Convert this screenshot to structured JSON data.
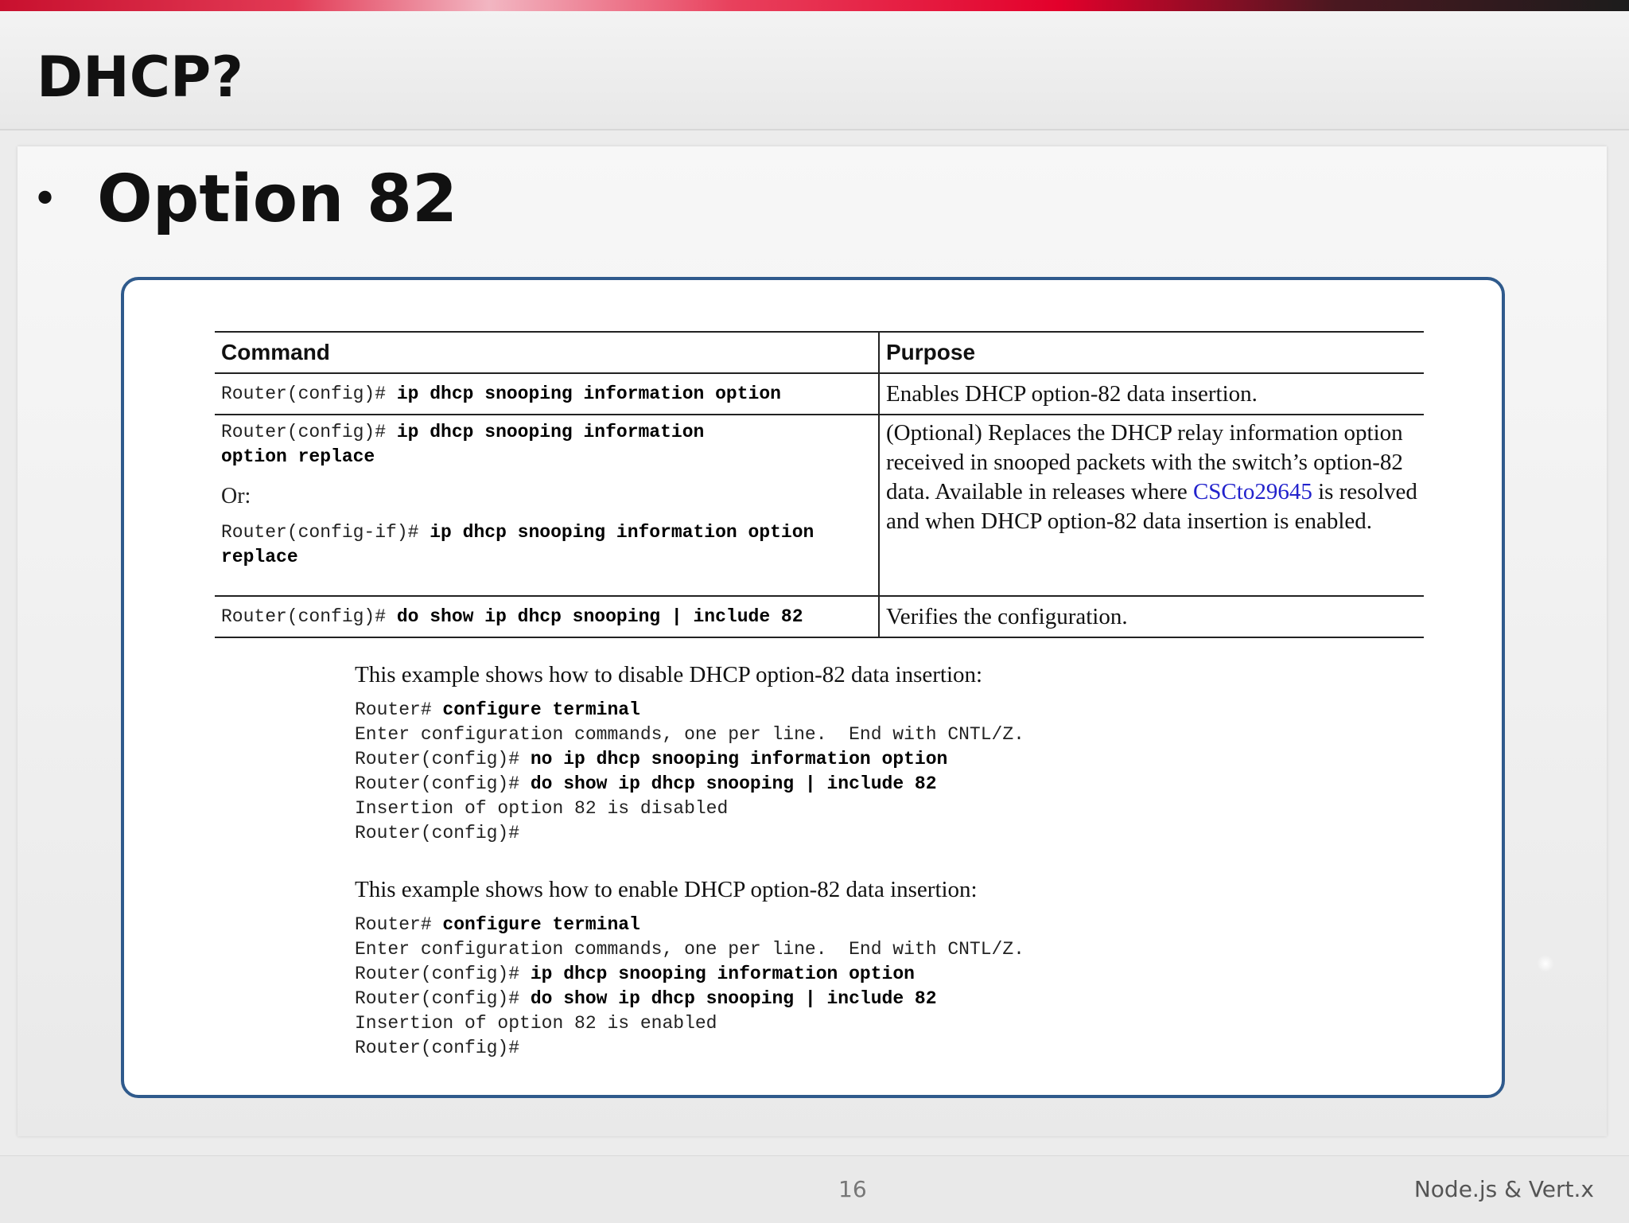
{
  "slide": {
    "title": "DHCP?",
    "bullet": "Option 82",
    "page_number": "16",
    "footer": "Node.js & Vert.x"
  },
  "table": {
    "headers": [
      "Command",
      "Purpose"
    ],
    "rows": [
      {
        "command": [
          {
            "prompt": "Router(config)# ",
            "cmd": "ip dhcp snooping information option"
          }
        ],
        "purpose": "Enables DHCP option-82 data insertion."
      },
      {
        "command": [
          {
            "prompt": "Router(config)# ",
            "cmd": "ip dhcp snooping information"
          },
          {
            "prompt": "",
            "cmd": "option replace"
          }
        ],
        "or": "Or:",
        "command_alt": [
          {
            "prompt": "Router(config-if)# ",
            "cmd": "ip dhcp snooping information option"
          },
          {
            "prompt": "",
            "cmd": "replace"
          }
        ],
        "purpose_before_link": "(Optional) Replaces the DHCP relay information option received in snooped packets with the switch’s option-82 data. Available in releases where ",
        "purpose_link": "CSCto29645",
        "purpose_after_link": " is resolved and when DHCP option-82 data insertion is enabled."
      },
      {
        "command": [
          {
            "prompt": "Router(config)# ",
            "cmd": "do show ip dhcp snooping | include 82"
          }
        ],
        "purpose": "Verifies the configuration."
      }
    ]
  },
  "examples": [
    {
      "caption": "This example shows how to disable DHCP option-82 data insertion:",
      "lines": [
        {
          "prompt": "Router# ",
          "cmd": "configure terminal"
        },
        {
          "prompt": "Enter configuration commands, one per line.  End with CNTL/Z.",
          "cmd": ""
        },
        {
          "prompt": "Router(config)# ",
          "cmd": "no ip dhcp snooping information option"
        },
        {
          "prompt": "Router(config)# ",
          "cmd": "do show ip dhcp snooping | include 82"
        },
        {
          "prompt": "Insertion of option 82 is disabled",
          "cmd": ""
        },
        {
          "prompt": "Router(config)#",
          "cmd": ""
        }
      ]
    },
    {
      "caption": "This example shows how to enable DHCP option-82 data insertion:",
      "lines": [
        {
          "prompt": "Router# ",
          "cmd": "configure terminal"
        },
        {
          "prompt": "Enter configuration commands, one per line.  End with CNTL/Z.",
          "cmd": ""
        },
        {
          "prompt": "Router(config)# ",
          "cmd": "ip dhcp snooping information option"
        },
        {
          "prompt": "Router(config)# ",
          "cmd": "do show ip dhcp snooping | include 82"
        },
        {
          "prompt": "Insertion of option 82 is enabled",
          "cmd": ""
        },
        {
          "prompt": "Router(config)#",
          "cmd": ""
        }
      ]
    }
  ],
  "colors": {
    "figure_border": "#2f5a8c",
    "link": "#2222cc",
    "accent_red": "#e3002b"
  }
}
